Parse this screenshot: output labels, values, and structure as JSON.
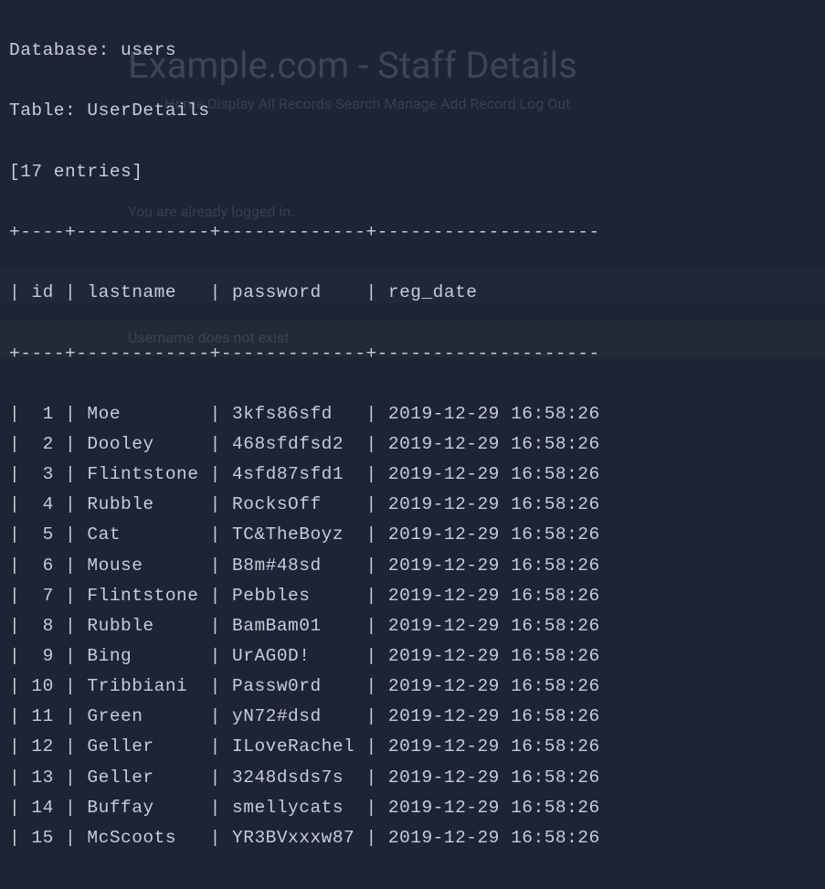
{
  "background_page": {
    "title": "Example.com - Staff Details",
    "nav": "Home   Display All Records   Search   Manage   Add Record   Log Out",
    "msg1": "You are already logged in.",
    "msg2": "Username does not exist"
  },
  "header": {
    "line1": "Database: users",
    "line2": "Table: UserDetails",
    "line3": "[17 entries]"
  },
  "divider": "+----+------------+-------------+----------------",
  "columns": {
    "id": "id",
    "lastname": "lastname",
    "password": "password",
    "reg_date": "reg_date"
  },
  "rows": [
    {
      "id": "1",
      "lastname": "Moe",
      "password": "3kfs86sfd",
      "reg_date": "2019-12-29 16:58:26"
    },
    {
      "id": "2",
      "lastname": "Dooley",
      "password": "468sfdfsd2",
      "reg_date": "2019-12-29 16:58:26"
    },
    {
      "id": "3",
      "lastname": "Flintstone",
      "password": "4sfd87sfd1",
      "reg_date": "2019-12-29 16:58:26"
    },
    {
      "id": "4",
      "lastname": "Rubble",
      "password": "RocksOff",
      "reg_date": "2019-12-29 16:58:26"
    },
    {
      "id": "5",
      "lastname": "Cat",
      "password": "TC&TheBoyz",
      "reg_date": "2019-12-29 16:58:26"
    },
    {
      "id": "6",
      "lastname": "Mouse",
      "password": "B8m#48sd",
      "reg_date": "2019-12-29 16:58:26"
    },
    {
      "id": "7",
      "lastname": "Flintstone",
      "password": "Pebbles",
      "reg_date": "2019-12-29 16:58:26"
    },
    {
      "id": "8",
      "lastname": "Rubble",
      "password": "BamBam01",
      "reg_date": "2019-12-29 16:58:26"
    },
    {
      "id": "9",
      "lastname": "Bing",
      "password": "UrAG0D!",
      "reg_date": "2019-12-29 16:58:26"
    },
    {
      "id": "10",
      "lastname": "Tribbiani",
      "password": "Passw0rd",
      "reg_date": "2019-12-29 16:58:26"
    },
    {
      "id": "11",
      "lastname": "Green",
      "password": "yN72#dsd",
      "reg_date": "2019-12-29 16:58:26"
    },
    {
      "id": "12",
      "lastname": "Geller",
      "password": "ILoveRachel",
      "reg_date": "2019-12-29 16:58:26"
    },
    {
      "id": "13",
      "lastname": "Geller",
      "password": "3248dsds7s",
      "reg_date": "2019-12-29 16:58:26"
    },
    {
      "id": "14",
      "lastname": "Buffay",
      "password": "smellycats",
      "reg_date": "2019-12-29 16:58:26"
    },
    {
      "id": "15",
      "lastname": "McScoots",
      "password": "YR3BVxxxw87",
      "reg_date": "2019-12-29 16:58:26"
    }
  ],
  "col_widths": {
    "id": 4,
    "lastname": 12,
    "password": 13,
    "reg_date": 20
  }
}
